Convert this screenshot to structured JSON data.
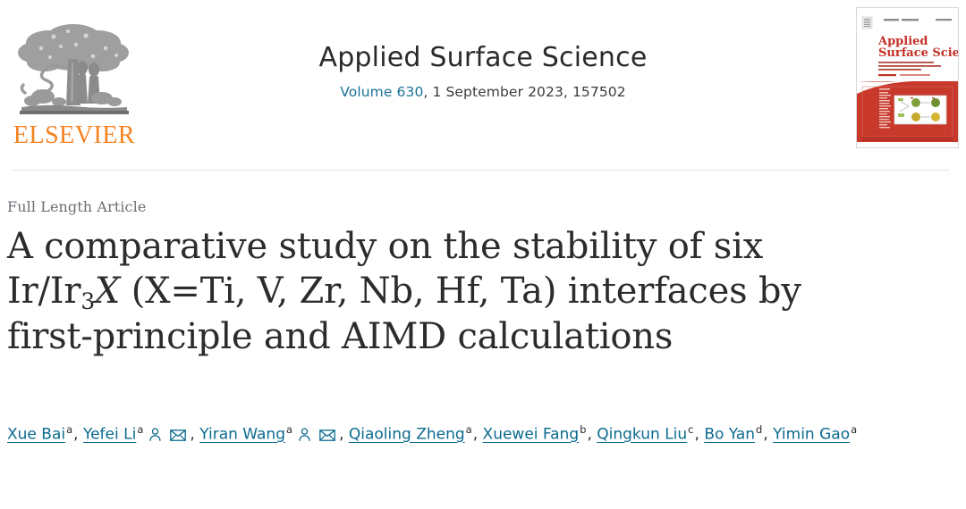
{
  "publisher": {
    "logo_name": "elsevier-tree-logo",
    "wordmark": "ELSEVIER",
    "wordmark_color": "#F5821F"
  },
  "journal": {
    "name": "Applied Surface Science",
    "volume_label": "Volume 630",
    "issue_meta": ", 1 September 2023, 157502",
    "link_color": "#1a7298",
    "cover": {
      "alt_name": "journal-cover-thumbnail",
      "title_line1": "Applied",
      "title_line2": "Surface Science",
      "cover_color": "#C9392B"
    }
  },
  "article": {
    "type_label": "Full Length Article",
    "title_parts": {
      "line1": "A comparative study on the stability of six",
      "line2_pre": "Ir/Ir",
      "line2_sub": "3",
      "line2_var": "X",
      "line2_post": " (X=Ti, V, Zr, Nb, Hf, Ta) interfaces by",
      "line3": "first-principle and AIMD calculations"
    },
    "title_plain": "A comparative study on the stability of six Ir/Ir3X (X=Ti, V, Zr, Nb, Hf, Ta) interfaces by first-principle and AIMD calculations"
  },
  "authors": {
    "link_color": "#0b6a8f",
    "list": [
      {
        "name": "Xue Bai",
        "affiliation": "a",
        "has_author_icon": false,
        "has_mail_icon": false,
        "trailing": ","
      },
      {
        "name": "Yefei Li",
        "affiliation": "a",
        "has_author_icon": true,
        "has_mail_icon": true,
        "trailing": ","
      },
      {
        "name": "Yiran Wang",
        "affiliation": "a",
        "has_author_icon": true,
        "has_mail_icon": true,
        "trailing": ","
      },
      {
        "name": "Qiaoling Zheng",
        "affiliation": "a",
        "has_author_icon": false,
        "has_mail_icon": false,
        "trailing": ","
      },
      {
        "name": "Xuewei Fang",
        "affiliation": "b",
        "has_author_icon": false,
        "has_mail_icon": false,
        "trailing": ","
      },
      {
        "name": "Qingkun Liu",
        "affiliation": "c",
        "has_author_icon": false,
        "has_mail_icon": false,
        "trailing": ","
      },
      {
        "name": "Bo Yan",
        "affiliation": "d",
        "has_author_icon": false,
        "has_mail_icon": false,
        "trailing": ","
      },
      {
        "name": "Yimin Gao",
        "affiliation": "a",
        "has_author_icon": false,
        "has_mail_icon": false,
        "trailing": ""
      }
    ],
    "icons": {
      "person": "author-profile-icon",
      "mail": "author-email-icon"
    }
  }
}
